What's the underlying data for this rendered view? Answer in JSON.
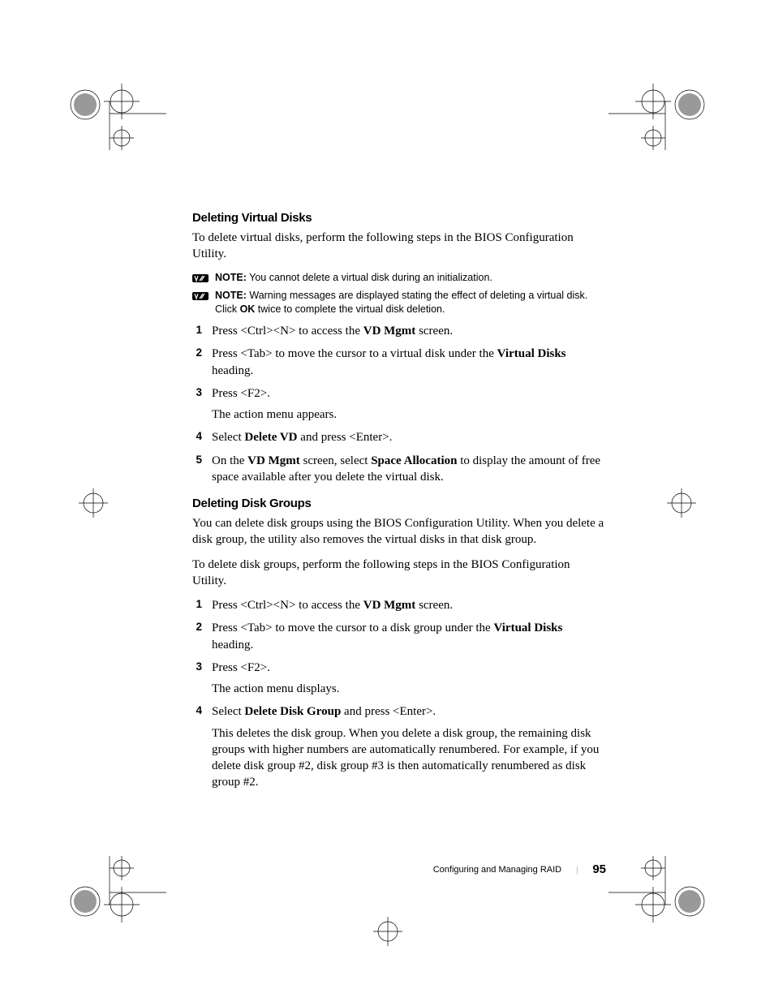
{
  "section1": {
    "heading": "Deleting Virtual Disks",
    "intro": "To delete virtual disks, perform the following steps in the BIOS Configuration Utility.",
    "note1_label": "NOTE:",
    "note1_text": " You cannot delete a virtual disk during an initialization.",
    "note2_label": "NOTE:",
    "note2_text_a": " Warning messages are displayed stating the effect of deleting a virtual disk. Click ",
    "note2_ok": "OK",
    "note2_text_b": " twice to complete the virtual disk deletion.",
    "steps": [
      {
        "n": "1",
        "a": "Press <Ctrl><N> to access the ",
        "b": "VD Mgmt",
        "c": " screen."
      },
      {
        "n": "2",
        "a": "Press <Tab> to move the cursor to a virtual disk under the ",
        "b": "Virtual Disks",
        "c": " heading."
      },
      {
        "n": "3",
        "a": "Press <F2>.",
        "p2": "The action menu appears."
      },
      {
        "n": "4",
        "a": "Select ",
        "b": "Delete VD",
        "c": " and press <Enter>."
      },
      {
        "n": "5",
        "a": "On the ",
        "b": "VD Mgmt",
        "c": " screen, select ",
        "d": "Space Allocation",
        "e": " to display the amount of free space available after you delete the virtual disk."
      }
    ]
  },
  "section2": {
    "heading": "Deleting Disk Groups",
    "intro1": "You can delete disk groups using the BIOS Configuration Utility. When you delete a disk group, the utility also removes the virtual disks in that disk group.",
    "intro2": "To delete disk groups, perform the following steps in the BIOS Configuration Utility.",
    "steps": [
      {
        "n": "1",
        "a": "Press <Ctrl><N> to access the ",
        "b": "VD Mgmt",
        "c": " screen."
      },
      {
        "n": "2",
        "a": "Press <Tab> to move the cursor to a disk group under the ",
        "b": "Virtual Disks",
        "c": " heading."
      },
      {
        "n": "3",
        "a": "Press <F2>.",
        "p2": "The action menu displays."
      },
      {
        "n": "4",
        "a": "Select ",
        "b": "Delete Disk Group",
        "c": " and press <Enter>.",
        "p2": "This deletes the disk group. When you delete a disk group, the remaining disk groups with higher numbers are automatically renumbered. For example, if you delete disk group #2, disk group #3 is then automatically renumbered as disk group #2."
      }
    ]
  },
  "footer": {
    "title": "Configuring and Managing RAID",
    "sep": "|",
    "page": "95"
  }
}
